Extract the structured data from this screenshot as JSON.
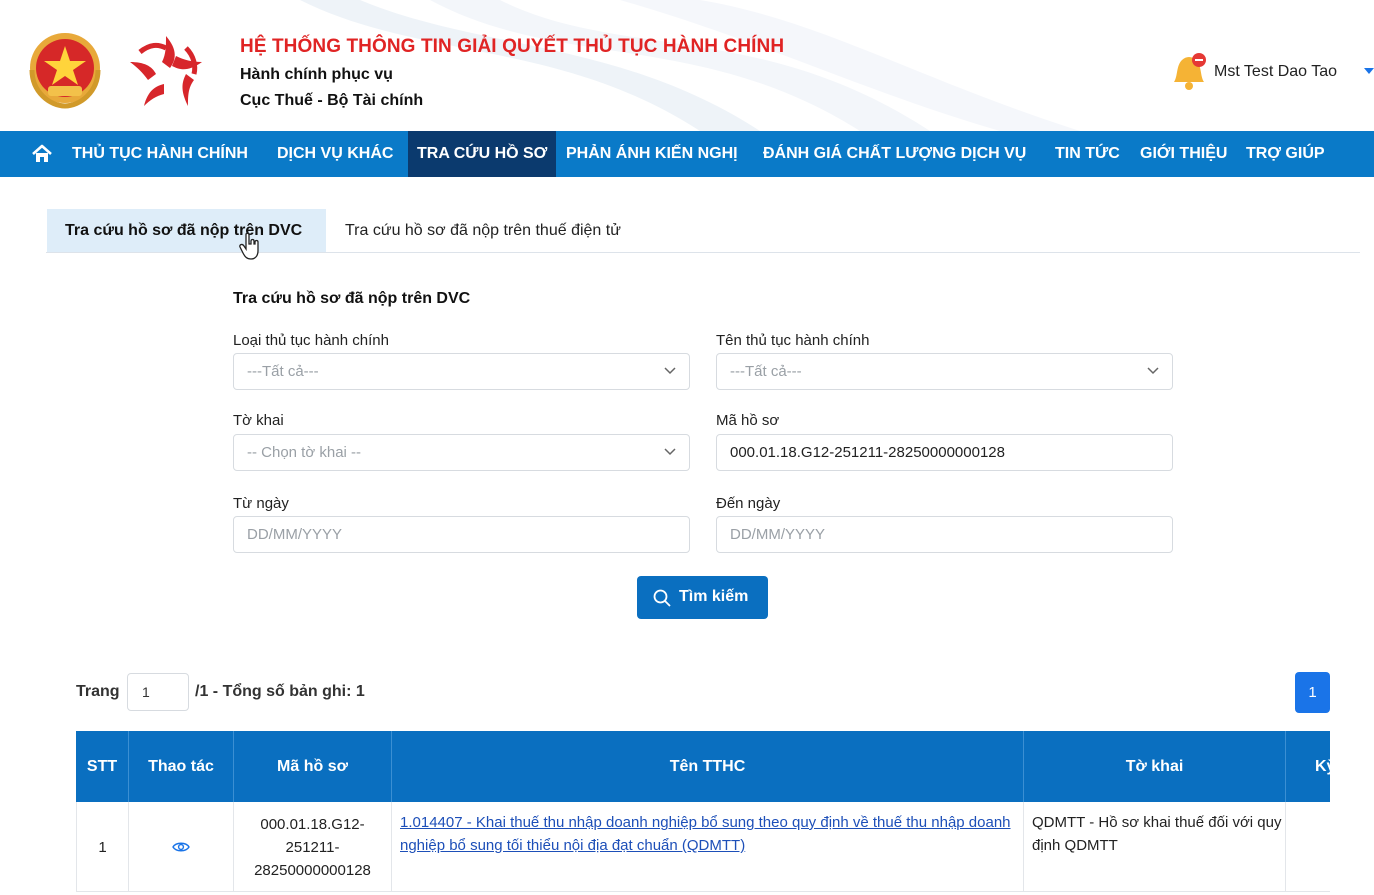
{
  "header": {
    "system_title": "HỆ THỐNG THÔNG TIN GIẢI QUYẾT THỦ TỤC HÀNH CHÍNH",
    "subtitle_1": "Hành chính phục vụ",
    "subtitle_2": "Cục Thuế - Bộ Tài chính",
    "user_name": "Mst Test Dao Tao",
    "icons": [
      "national-emblem-icon",
      "star-logo-icon",
      "bell-icon",
      "caret-down-icon"
    ]
  },
  "nav": {
    "items": [
      {
        "label": "THỦ TỤC HÀNH CHÍNH"
      },
      {
        "label": "DỊCH VỤ KHÁC"
      },
      {
        "label": "TRA CỨU HỒ SƠ",
        "active": true
      },
      {
        "label": "PHẢN ÁNH KIẾN NGHỊ"
      },
      {
        "label": "ĐÁNH GIÁ CHẤT LƯỢNG DỊCH VỤ"
      },
      {
        "label": "TIN TỨC"
      },
      {
        "label": "GIỚI THIỆU"
      },
      {
        "label": "TRỢ GIÚP"
      }
    ],
    "bg_color": "#0a7ac8",
    "active_color": "#0b3a6e"
  },
  "tabs": [
    {
      "label": "Tra cứu hồ sơ đã nộp trên DVC",
      "active": true
    },
    {
      "label": "Tra cứu hồ sơ đã nộp trên thuế điện tử",
      "active": false
    }
  ],
  "form": {
    "title": "Tra cứu hồ sơ đã nộp trên DVC",
    "loai_tthc": {
      "label": "Loại thủ tục hành chính",
      "value": "---Tất cả---"
    },
    "ten_tthc": {
      "label": "Tên thủ tục hành chính",
      "value": "---Tất cả---"
    },
    "to_khai": {
      "label": "Tờ khai",
      "value": "-- Chọn tờ khai --"
    },
    "ma_ho_so": {
      "label": "Mã hồ sơ",
      "value": "000.01.18.G12-251211-28250000000128"
    },
    "tu_ngay": {
      "label": "Từ ngày",
      "placeholder": "DD/MM/YYYY"
    },
    "den_ngay": {
      "label": "Đến ngày",
      "placeholder": "DD/MM/YYYY"
    },
    "search_label": "Tìm kiếm"
  },
  "pagination": {
    "page_label": "Trang",
    "page_value": "1",
    "total_text": "/1 - Tổng số bản ghi: 1",
    "current_page": "1"
  },
  "table": {
    "headers": [
      "STT",
      "Thao tác",
      "Mã hồ sơ",
      "Tên TTHC",
      "Tờ khai",
      "Kỳ"
    ],
    "rows": [
      {
        "stt": "1",
        "action_icon": "eye-icon",
        "ma_ho_so": "000.01.18.G12-251211-28250000000128",
        "ten_tthc": "1.014407 - Khai thuế thu nhập doanh nghiệp bổ sung theo quy định về thuế thu nhập doanh nghiệp bổ sung tối thiểu nội địa đạt chuẩn (QDMTT)",
        "to_khai": "QDMTT - Hồ sơ khai thuế đối với quy định QDMTT"
      }
    ],
    "header_color": "#0a6fc0"
  }
}
